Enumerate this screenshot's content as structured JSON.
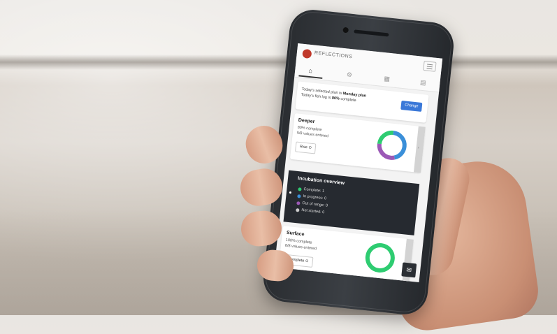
{
  "app": {
    "name": "REFLECTIONS",
    "tabs": [
      "home",
      "settings",
      "calendar",
      "records"
    ]
  },
  "plan_banner": {
    "line1_prefix": "Today's selected plan is ",
    "line1_bold": "Monday plan",
    "line2_prefix": "Today's fish log is ",
    "line2_bold": "80%",
    "line2_suffix": " complete",
    "button_label": "Change"
  },
  "sections": [
    {
      "title": "Deeper",
      "line1": "80% complete",
      "line2": "5/8 values entered",
      "button_label": "Rise ⊙",
      "segments": [
        {
          "color": "#3a8fd9",
          "fraction": 0.45
        },
        {
          "color": "#9b59b6",
          "fraction": 0.3
        },
        {
          "color": "#2ecc71",
          "fraction": 0.25
        }
      ]
    },
    {
      "title": "Surface",
      "line1": "100% complete",
      "line2": "8/8 values entered",
      "button_label": "Complete ⊙",
      "segments": [
        {
          "color": "#2ecc71",
          "fraction": 1.0
        }
      ]
    }
  ],
  "overview": {
    "title": "Incubation overview",
    "items": [
      {
        "label": "Complete: 1",
        "color": "#2ecc71"
      },
      {
        "label": "In progress: 0",
        "color": "#3a8fd9"
      },
      {
        "label": "Out of range: 0",
        "color": "#9b59b6"
      },
      {
        "label": "Not started: 0",
        "color": "#cccccc"
      }
    ]
  },
  "chat_icon": "chat-icon"
}
